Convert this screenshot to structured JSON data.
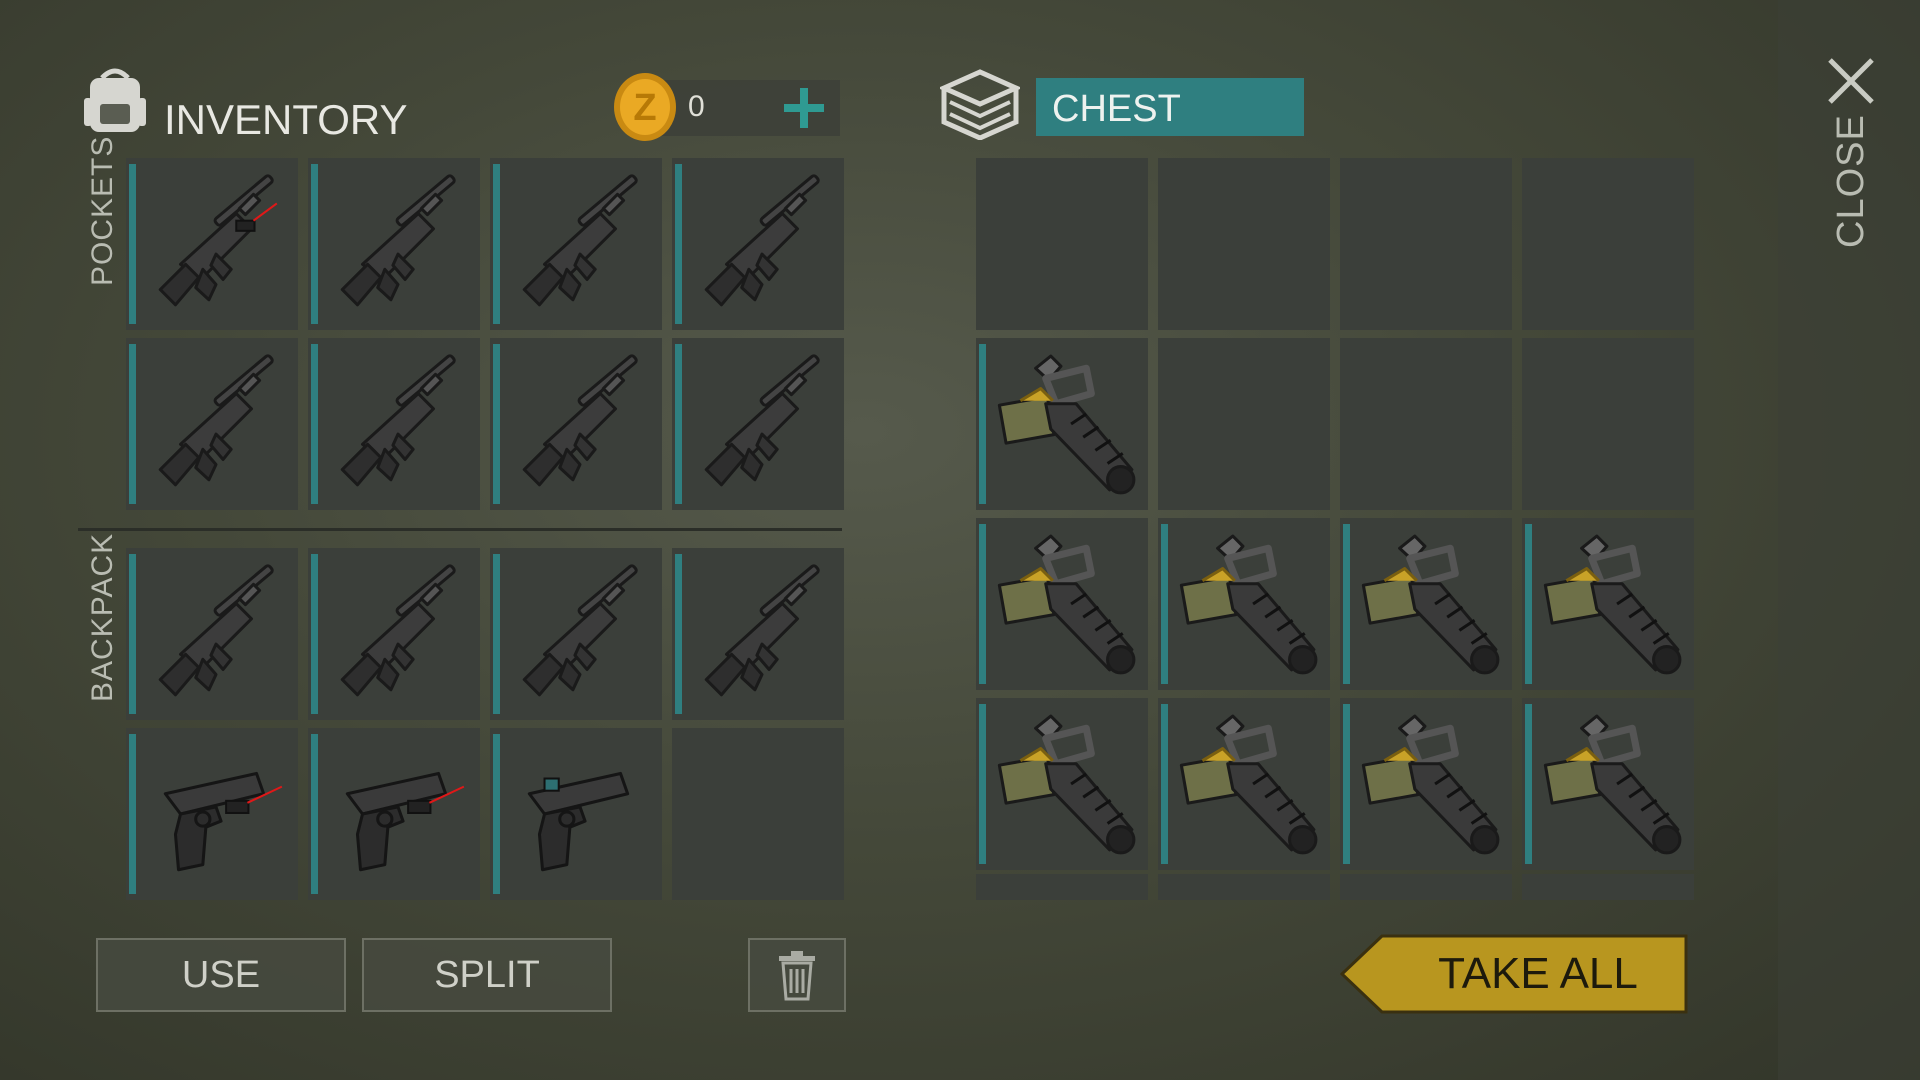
{
  "inventory": {
    "title": "INVENTORY",
    "coins": "0",
    "add_icon": "plus-icon",
    "sections": {
      "pockets": "POCKETS",
      "backpack": "BACKPACK"
    },
    "pocket_items": [
      "rifle-laser",
      "rifle",
      "rifle",
      "rifle",
      "rifle",
      "rifle",
      "rifle",
      "rifle"
    ],
    "backpack_items": [
      "rifle",
      "rifle",
      "rifle",
      "rifle",
      "pistol-laser",
      "pistol-laser",
      "pistol-sight",
      "empty"
    ]
  },
  "chest": {
    "title": "CHEST",
    "items": [
      "empty",
      "empty",
      "empty",
      "empty",
      "minigun",
      "empty",
      "empty",
      "empty",
      "minigun",
      "minigun",
      "minigun",
      "minigun",
      "minigun",
      "minigun",
      "minigun",
      "minigun"
    ]
  },
  "buttons": {
    "use": "USE",
    "split": "SPLIT",
    "take_all": "TAKE ALL",
    "close": "CLOSE"
  },
  "colors": {
    "accent": "#2f7f80",
    "gold": "#c9a227",
    "slot": "#3b3f3a"
  }
}
